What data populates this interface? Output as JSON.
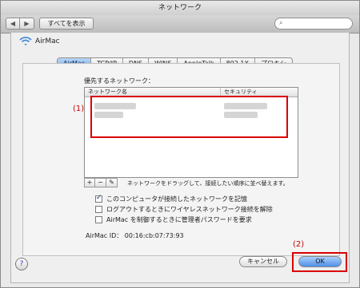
{
  "window": {
    "title": "ネットワーク"
  },
  "toolbar": {
    "show_all_label": "すべてを表示",
    "search_placeholder": ""
  },
  "sheet": {
    "title": "AirMac",
    "tabs": [
      "AirMac",
      "TCP/IP",
      "DNS",
      "WINS",
      "AppleTalk",
      "802.1X",
      "プロキシ"
    ]
  },
  "network_section": {
    "label": "優先するネットワーク：",
    "columns": [
      "ネットワーク名",
      "セキュリティ"
    ],
    "hint": "ネットワークをドラッグして、接続したい順序に並べ替えます。",
    "buttons": [
      "+",
      "−",
      "✎"
    ]
  },
  "annotations": {
    "label_1": "(1)",
    "label_2": "(2)"
  },
  "checkboxes": [
    {
      "label": "このコンピュータが接続したネットワークを記憶",
      "checked": true
    },
    {
      "label": "ログアウトするときにワイヤレスネットワーク接続を解除",
      "checked": false
    },
    {
      "label": "AirMac を制御するときに管理者パスワードを要求",
      "checked": false
    }
  ],
  "airmac_id": {
    "label": "AirMac ID：",
    "value": "00:16:cb:07:73:93"
  },
  "buttons": {
    "help": "?",
    "cancel": "キャンセル",
    "ok": "OK"
  }
}
